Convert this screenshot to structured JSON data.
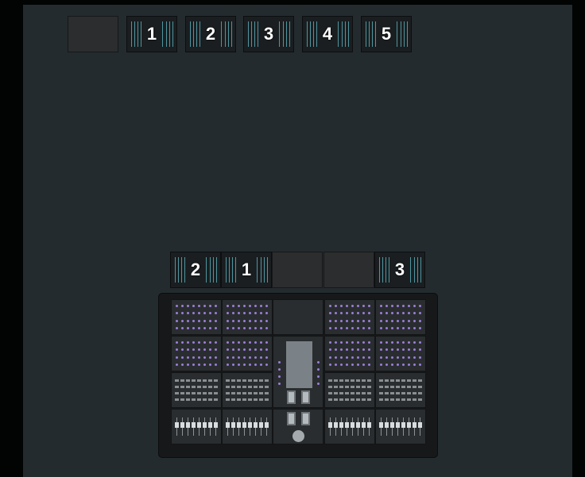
{
  "palette": {
    "window_bg": "#242b2f",
    "outer_bg": "#020303",
    "slot_bg": "#1a1e20",
    "empty_slot_bg": "#2b2d2e",
    "slot_line": "#4f95a0",
    "label_text": "#ffffff",
    "console_bg": "#161819",
    "button_accent": "#9b7fd9"
  },
  "top_row": {
    "slots": [
      {
        "label": "",
        "empty": true
      },
      {
        "label": "1",
        "empty": false
      },
      {
        "label": "2",
        "empty": false
      },
      {
        "label": "3",
        "empty": false
      },
      {
        "label": "4",
        "empty": false
      },
      {
        "label": "5",
        "empty": false
      }
    ]
  },
  "console_row": {
    "slots": [
      {
        "label": "2",
        "empty": false
      },
      {
        "label": "1",
        "empty": false
      },
      {
        "label": "",
        "empty": true
      },
      {
        "label": "",
        "empty": true
      },
      {
        "label": "3",
        "empty": false
      }
    ]
  },
  "console": {
    "bays": [
      "left-1",
      "left-2",
      "master",
      "right-1",
      "right-2"
    ]
  }
}
